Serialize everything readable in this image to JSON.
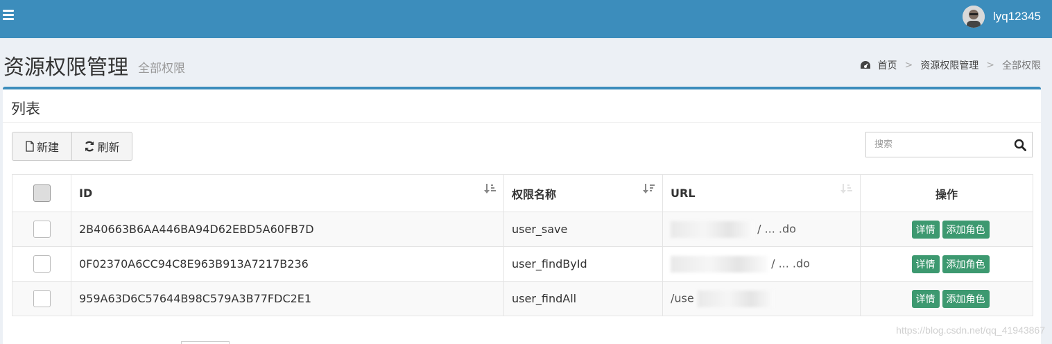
{
  "header": {
    "username": "lyq12345",
    "menu_icon": "hamburger-icon"
  },
  "page": {
    "title": "资源权限管理",
    "subtitle": "全部权限"
  },
  "breadcrumb": {
    "items": [
      "首页",
      "资源权限管理",
      "全部权限"
    ],
    "separator": ">"
  },
  "box": {
    "title": "列表"
  },
  "toolbar": {
    "new_label": "新建",
    "refresh_label": "刷新"
  },
  "search": {
    "placeholder": "搜索"
  },
  "table": {
    "columns": [
      "ID",
      "权限名称",
      "URL",
      "操作"
    ],
    "rows": [
      {
        "id": "2B40663B6AA446BA94D62EBD5A60FB7D",
        "name": "user_save",
        "url_visible": "/ ... .do"
      },
      {
        "id": "0F02370A6CC94C8E963B913A7217B236",
        "name": "user_findById",
        "url_visible": "/ ... .do"
      },
      {
        "id": "959A63D6C57644B98C579A3B77FDC2E1",
        "name": "user_findAll",
        "url_visible": "/use"
      }
    ],
    "row_actions": {
      "detail_label": "详情",
      "add_role_label": "添加角色"
    }
  },
  "watermark": "https://blog.csdn.net/qq_41943867",
  "colors": {
    "topbar": "#3c8dbc",
    "action_button": "#3d9970",
    "page_background": "#ecf0f5"
  }
}
